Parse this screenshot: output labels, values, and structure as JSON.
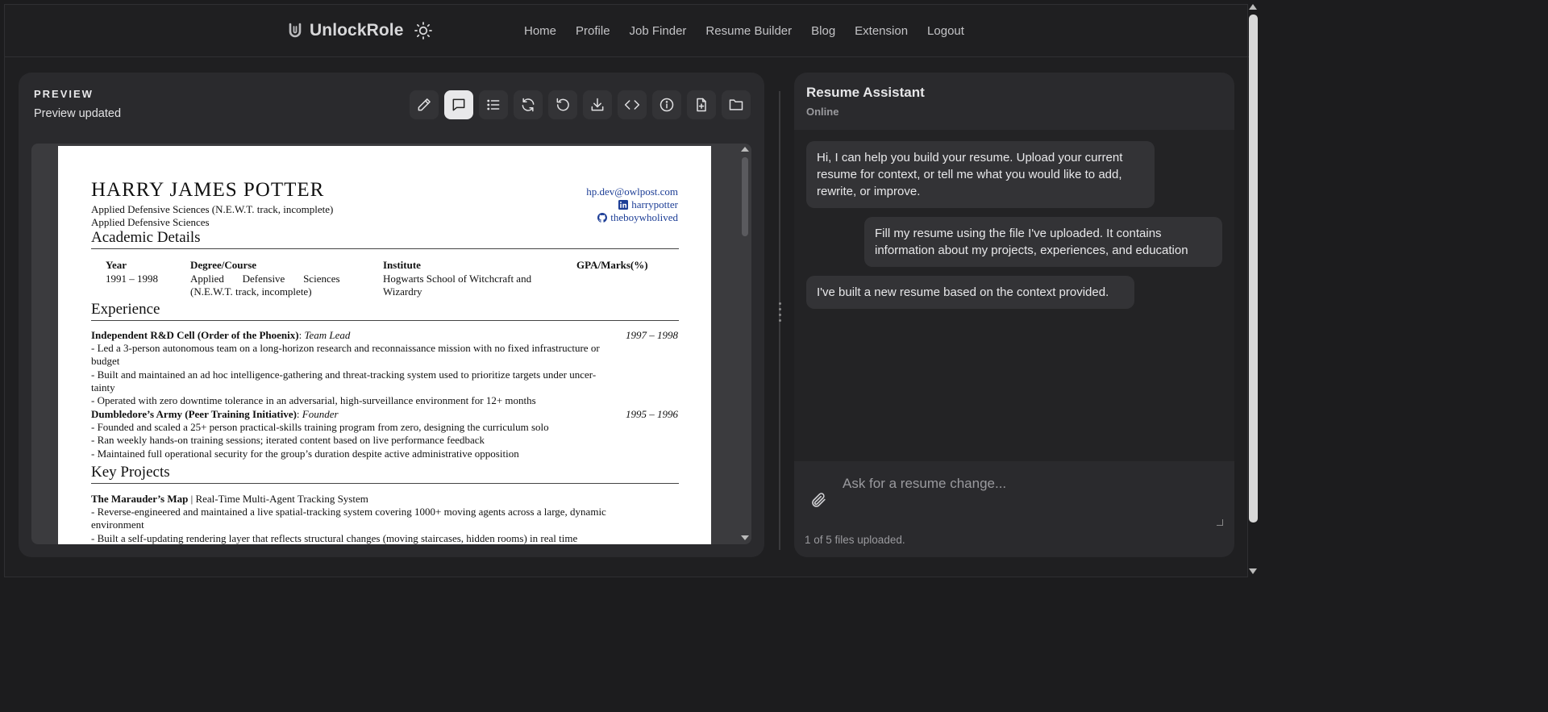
{
  "header": {
    "brand": "UnlockRole",
    "nav": [
      "Home",
      "Profile",
      "Job Finder",
      "Resume Builder",
      "Blog",
      "Extension",
      "Logout"
    ]
  },
  "preview": {
    "label": "PREVIEW",
    "status": "Preview updated",
    "toolbar_icons": [
      "pencil-icon",
      "chat-icon",
      "list-icon",
      "refresh-icon",
      "undo-icon",
      "download-icon",
      "code-icon",
      "info-icon",
      "file-plus-icon",
      "folder-icon"
    ],
    "active_tool": "chat-icon"
  },
  "resume": {
    "name": "HARRY JAMES POTTER",
    "subtitle1": "Applied Defensive Sciences (N.E.W.T. track, incomplete)",
    "subtitle2": "Applied Defensive Sciences",
    "email": "hp.dev@owlpost.com",
    "linkedin": "harrypotter",
    "github": "theboywholived",
    "sec_academic": "Academic Details",
    "table_headers": [
      "Year",
      "Degree/Course",
      "Institute",
      "GPA/Marks(%)"
    ],
    "table_row": {
      "year": "1991 – 1998",
      "degree_line1": "Applied       Defensive       Sciences",
      "degree_line2": "(N.E.W.T. track, incomplete)",
      "institute_line1": "Hogwarts School of Witchcraft and",
      "institute_line2": "Wizardry"
    },
    "sec_experience": "Experience",
    "exp1": {
      "org": "Independent R&D Cell (Order of the Phoenix)",
      "role": "Team Lead",
      "dates": "1997 – 1998",
      "b1a": "- Led a 3-person autonomous team on a long-horizon research and reconnaissance mission with no fixed infrastructure or",
      "b1b": "budget",
      "b2a": "- Built and maintained an ad hoc intelligence-gathering and threat-tracking system used to prioritize targets under uncer-",
      "b2b": "tainty",
      "b3": "- Operated with zero downtime tolerance in an adversarial, high-surveillance environment for 12+ months"
    },
    "exp2": {
      "org": "Dumbledore’s Army (Peer Training Initiative)",
      "role": "Founder",
      "dates": "1995 – 1996",
      "b1": "- Founded and scaled a 25+ person practical-skills training program from zero, designing the curriculum solo",
      "b2": "- Ran weekly hands-on training sessions; iterated content based on live performance feedback",
      "b3": "- Maintained full operational security for the group’s duration despite active administrative opposition"
    },
    "sec_projects": "Key Projects",
    "proj1": {
      "name": "The Marauder’s Map",
      "desc": " | Real-Time Multi-Agent Tracking System",
      "b1a": "- Reverse-engineered and maintained a live spatial-tracking system covering 1000+ moving agents across a large, dynamic",
      "b1b": "environment",
      "b2": "- Built a self-updating rendering layer that reflects structural changes (moving staircases, hidden rooms) in real time"
    }
  },
  "assistant": {
    "title": "Resume Assistant",
    "status": "Online",
    "messages": [
      {
        "from": "assistant",
        "line1": "Hi, I can help you build your resume. Upload your current",
        "line2": "resume for context, or tell me what you would like to add,",
        "line3": "rewrite, or improve."
      },
      {
        "from": "user",
        "line1": "Fill my resume using the file I've uploaded. It contains",
        "line2": "information about my projects, experiences, and education"
      },
      {
        "from": "assistant",
        "line1": "I've built a new resume based on the context provided."
      }
    ],
    "input_placeholder": "Ask for a resume change...",
    "files_status": "1 of 5 files uploaded."
  }
}
